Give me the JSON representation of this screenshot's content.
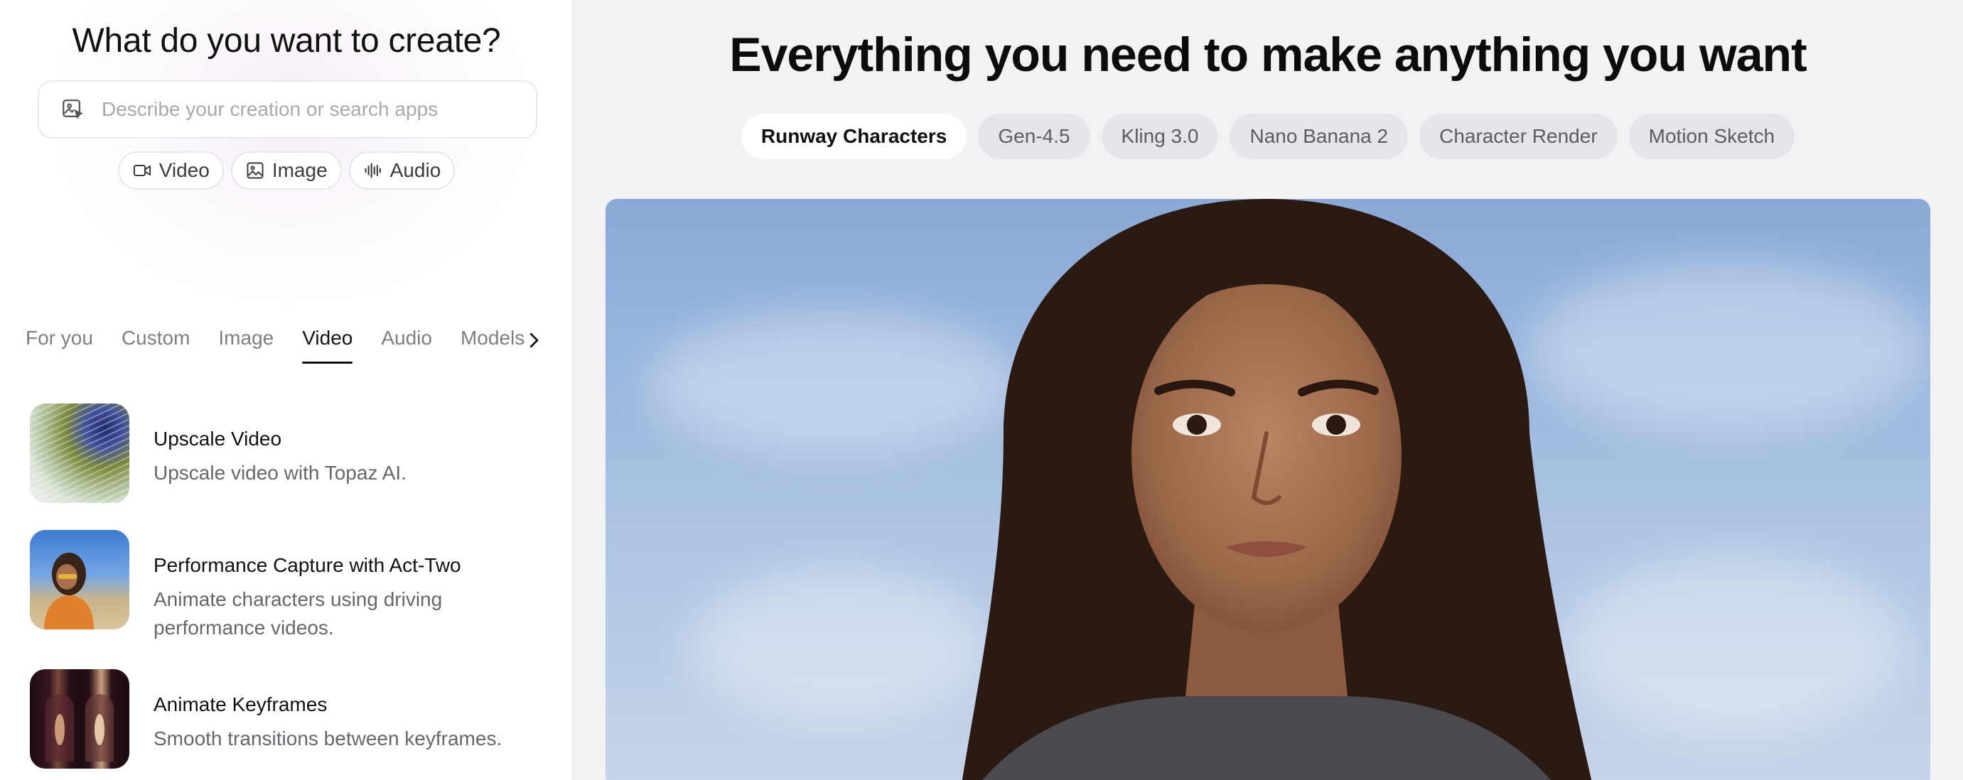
{
  "create_panel": {
    "title": "What do you want to create?",
    "search_placeholder": "Describe your creation or search apps",
    "media_chips": [
      {
        "label": "Video",
        "icon": "video-camera-icon"
      },
      {
        "label": "Image",
        "icon": "image-icon"
      },
      {
        "label": "Audio",
        "icon": "audio-waveform-icon"
      }
    ]
  },
  "category_tabs": {
    "items": [
      "For you",
      "Custom",
      "Image",
      "Video",
      "Audio",
      "Models"
    ],
    "active": "Video"
  },
  "apps": [
    {
      "name": "Upscale Video",
      "description": "Upscale video with Topaz AI."
    },
    {
      "name": "Performance Capture with Act-Two",
      "description": "Animate characters using driving performance videos."
    },
    {
      "name": "Animate Keyframes",
      "description": "Smooth transitions between keyframes."
    }
  ],
  "hero": {
    "title": "Everything you need to make anything you want",
    "models": [
      "Runway Characters",
      "Gen-4.5",
      "Kling 3.0",
      "Nano Banana 2",
      "Character Render",
      "Motion Sketch"
    ],
    "active_model": "Runway Characters"
  }
}
